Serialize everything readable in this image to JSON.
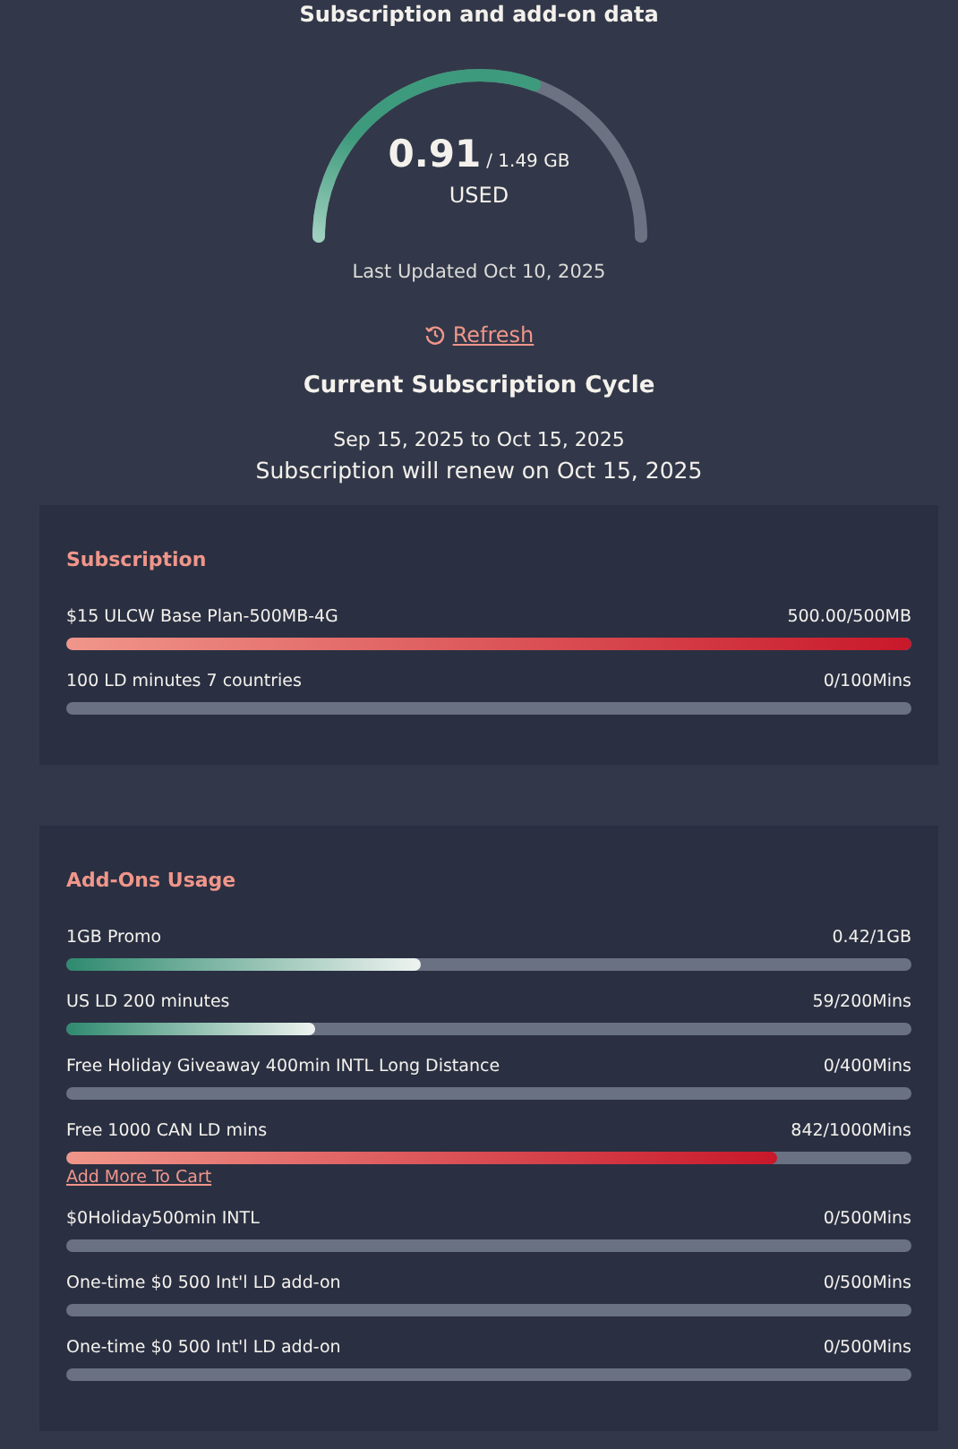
{
  "title": "Subscription and add-on data",
  "gauge": {
    "used": "0.91",
    "total": "/ 1.49 GB",
    "label": "USED",
    "updated": "Last Updated Oct 10, 2025"
  },
  "refresh": {
    "label": "Refresh"
  },
  "cycle": {
    "heading": "Current Subscription Cycle",
    "dates": "Sep 15, 2025 to Oct 15, 2025",
    "renewal": "Subscription will renew on Oct 15, 2025"
  },
  "sections": [
    {
      "heading": "Subscription",
      "items": [
        {
          "name": "$15 ULCW Base Plan-500MB-4G",
          "usage": "500.00/500MB",
          "level": 1.0,
          "kind": "red"
        },
        {
          "name": "100 LD minutes 7 countries",
          "usage": "0/100Mins"
        }
      ]
    },
    {
      "heading": "Add-Ons Usage",
      "items": [
        {
          "name": "1GB Promo",
          "usage": "0.42/1GB",
          "level": 0.42,
          "kind": "teal"
        },
        {
          "name": "US LD 200 minutes",
          "usage": "59/200Mins",
          "level": 0.295,
          "kind": "teal"
        },
        {
          "name": "Free Holiday Giveaway 400min INTL Long Distance",
          "usage": "0/400Mins"
        },
        {
          "name": "Free 1000 CAN LD mins",
          "usage": "842/1000Mins",
          "level": 0.842,
          "kind": "red",
          "link": "Add More To Cart"
        },
        {
          "name": "$0Holiday500min INTL",
          "usage": "0/500Mins"
        },
        {
          "name": "One-time $0 500 Int'l LD add-on",
          "usage": "0/500Mins"
        },
        {
          "name": "One-time $0 500 Int'l LD add-on",
          "usage": "0/500Mins"
        }
      ]
    }
  ]
}
